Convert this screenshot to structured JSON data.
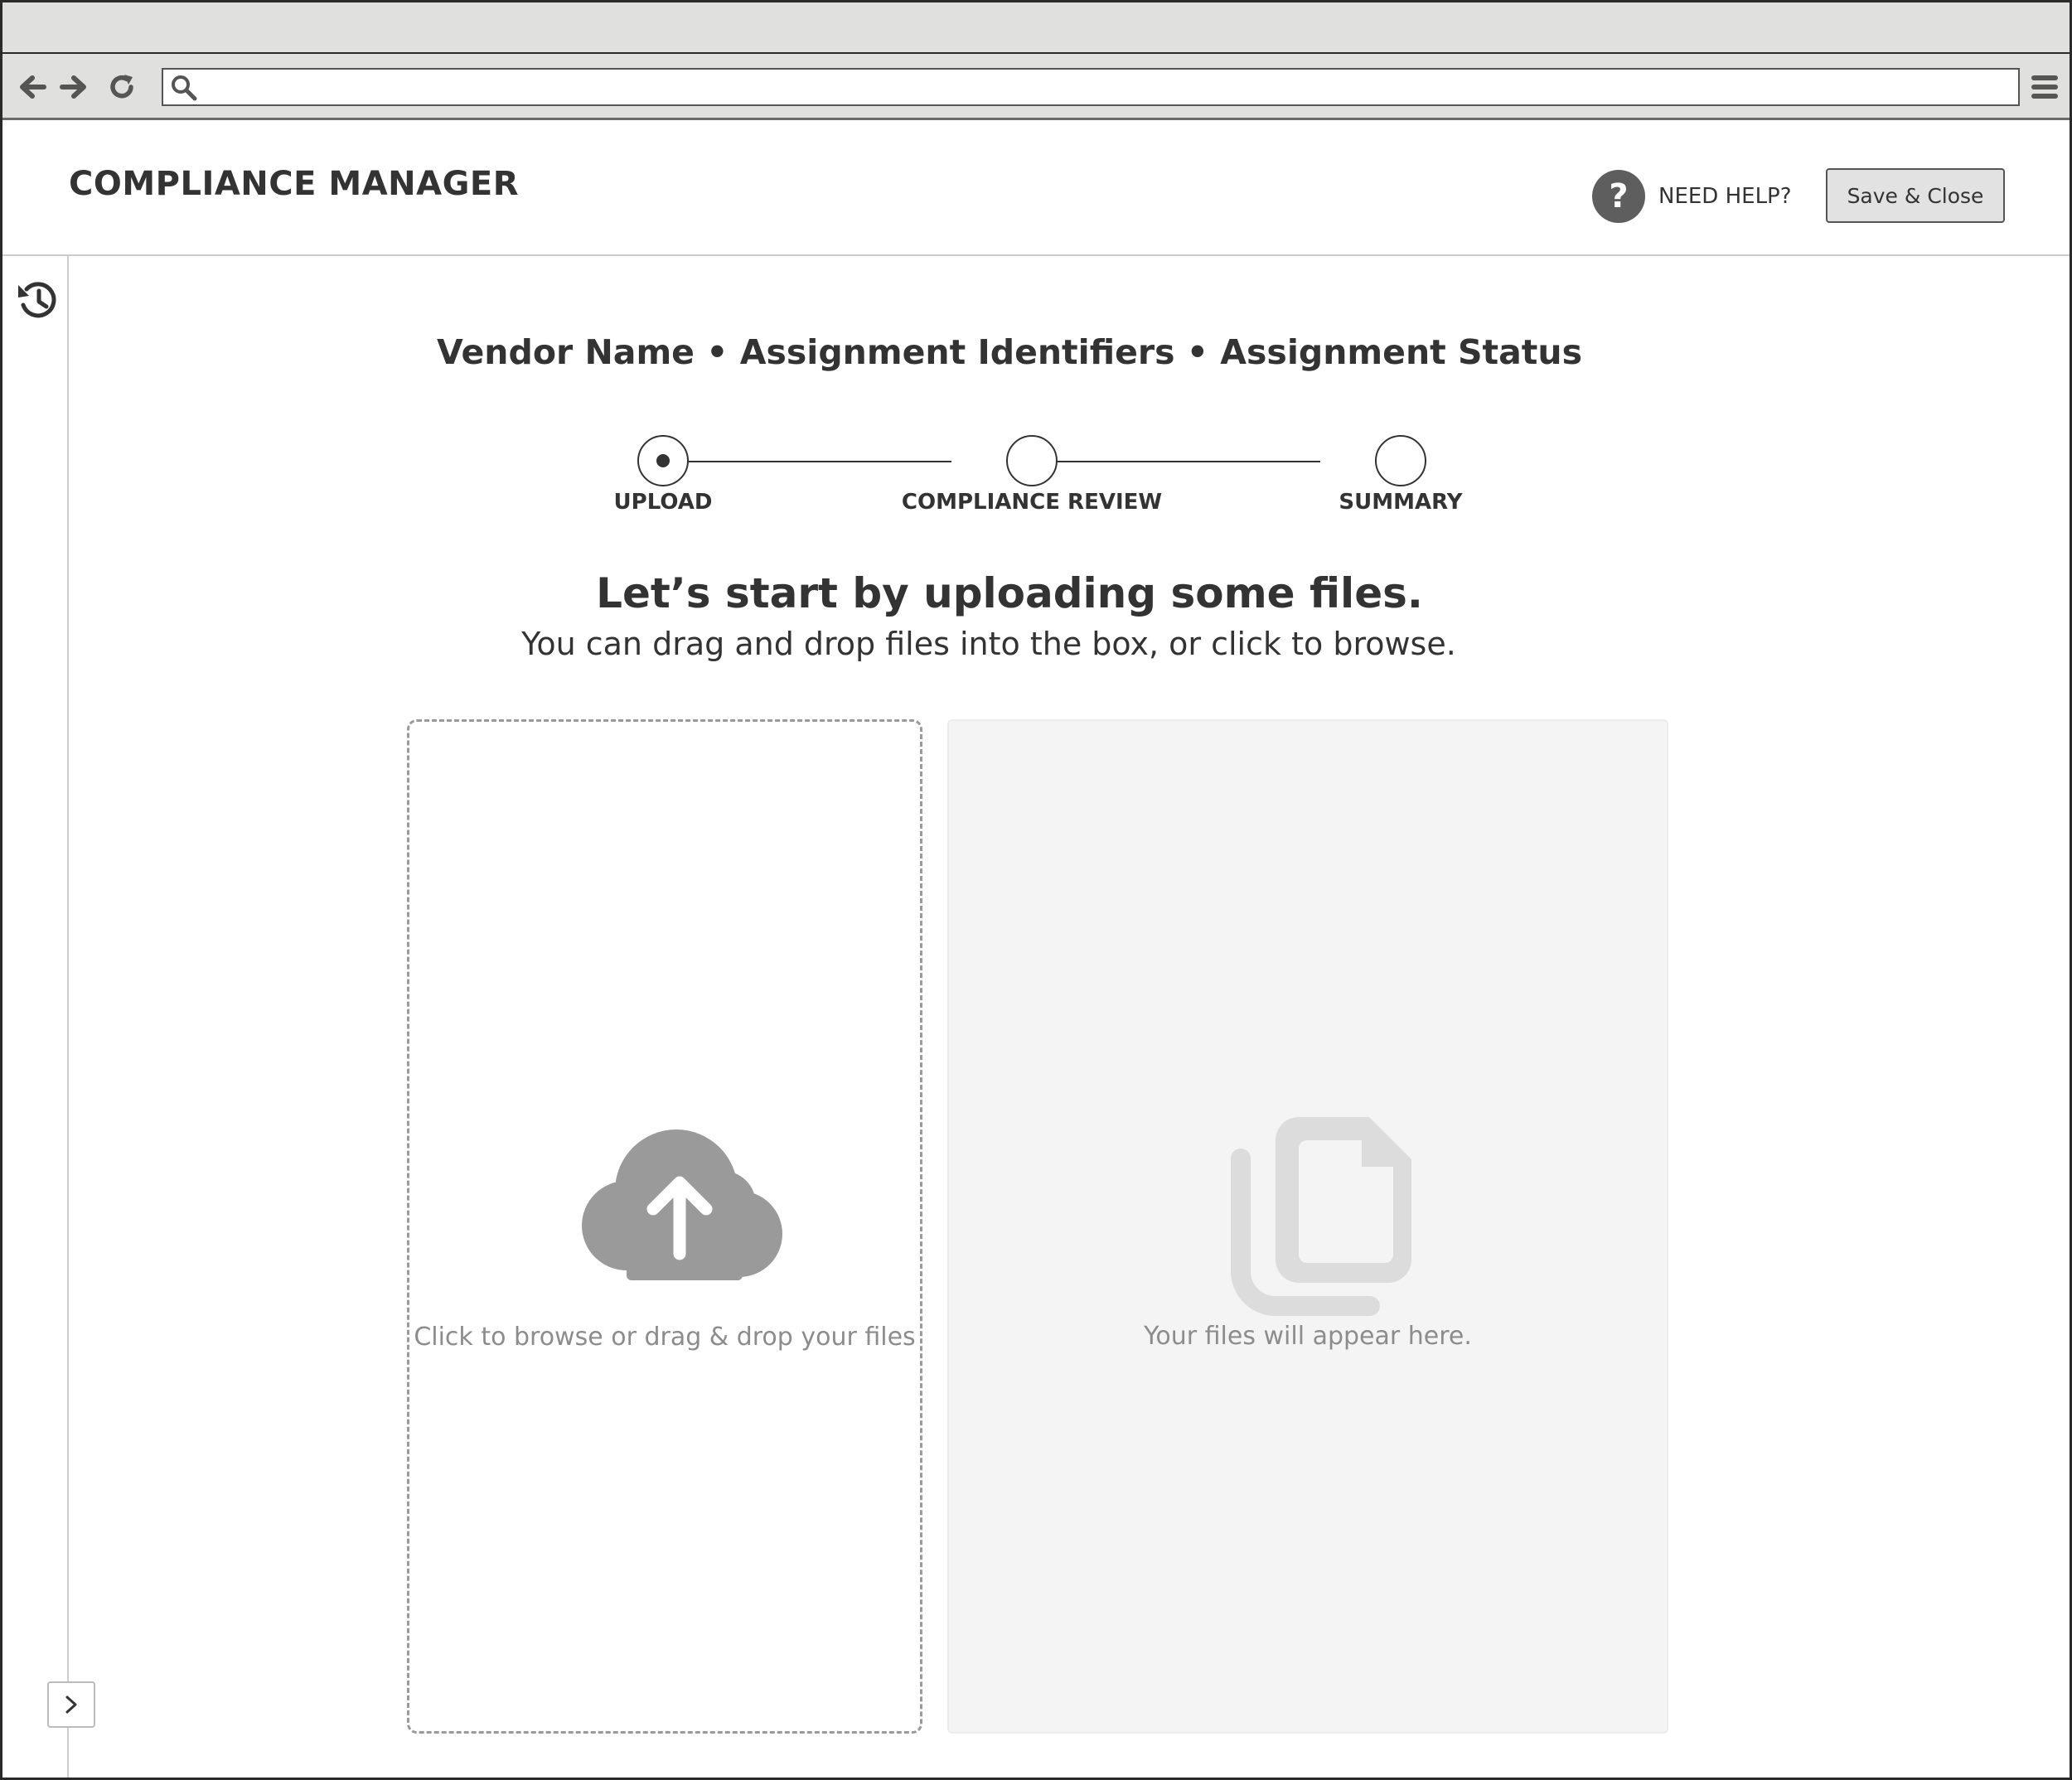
{
  "browser": {
    "url": "",
    "icons": {
      "back": "arrow-left-icon",
      "forward": "arrow-right-icon",
      "reload": "reload-icon",
      "search": "search-icon",
      "menu": "hamburger-menu-icon"
    }
  },
  "header": {
    "title": "COMPLIANCE MANAGER",
    "help_label": "NEED HELP?",
    "help_glyph": "?",
    "save_label": "Save & Close"
  },
  "sidebar": {
    "icons": {
      "history": "history-icon",
      "expand": "chevron-right-icon"
    }
  },
  "context_line": "Vendor Name • Assignment Identifiers • Assignment Status",
  "stepper": {
    "active_index": 0,
    "steps": [
      {
        "label": "UPLOAD"
      },
      {
        "label": "COMPLIANCE REVIEW"
      },
      {
        "label": "SUMMARY"
      }
    ]
  },
  "upload": {
    "headline": "Let’s start by uploading some files.",
    "subline": "You can drag and drop files into the box, or click to browse.",
    "dropzone_text": "Click to browse or drag & drop your files",
    "empty_state_text": "Your files will appear here.",
    "icons": {
      "dropzone": "cloud-upload-icon",
      "empty_state": "files-copy-icon"
    }
  },
  "colors": {
    "chrome": "#e0e0de",
    "text": "#333333",
    "muted_text": "#8c8c8c",
    "icon_gray": "#9a9a9a",
    "empty_panel": "#f4f4f4"
  }
}
